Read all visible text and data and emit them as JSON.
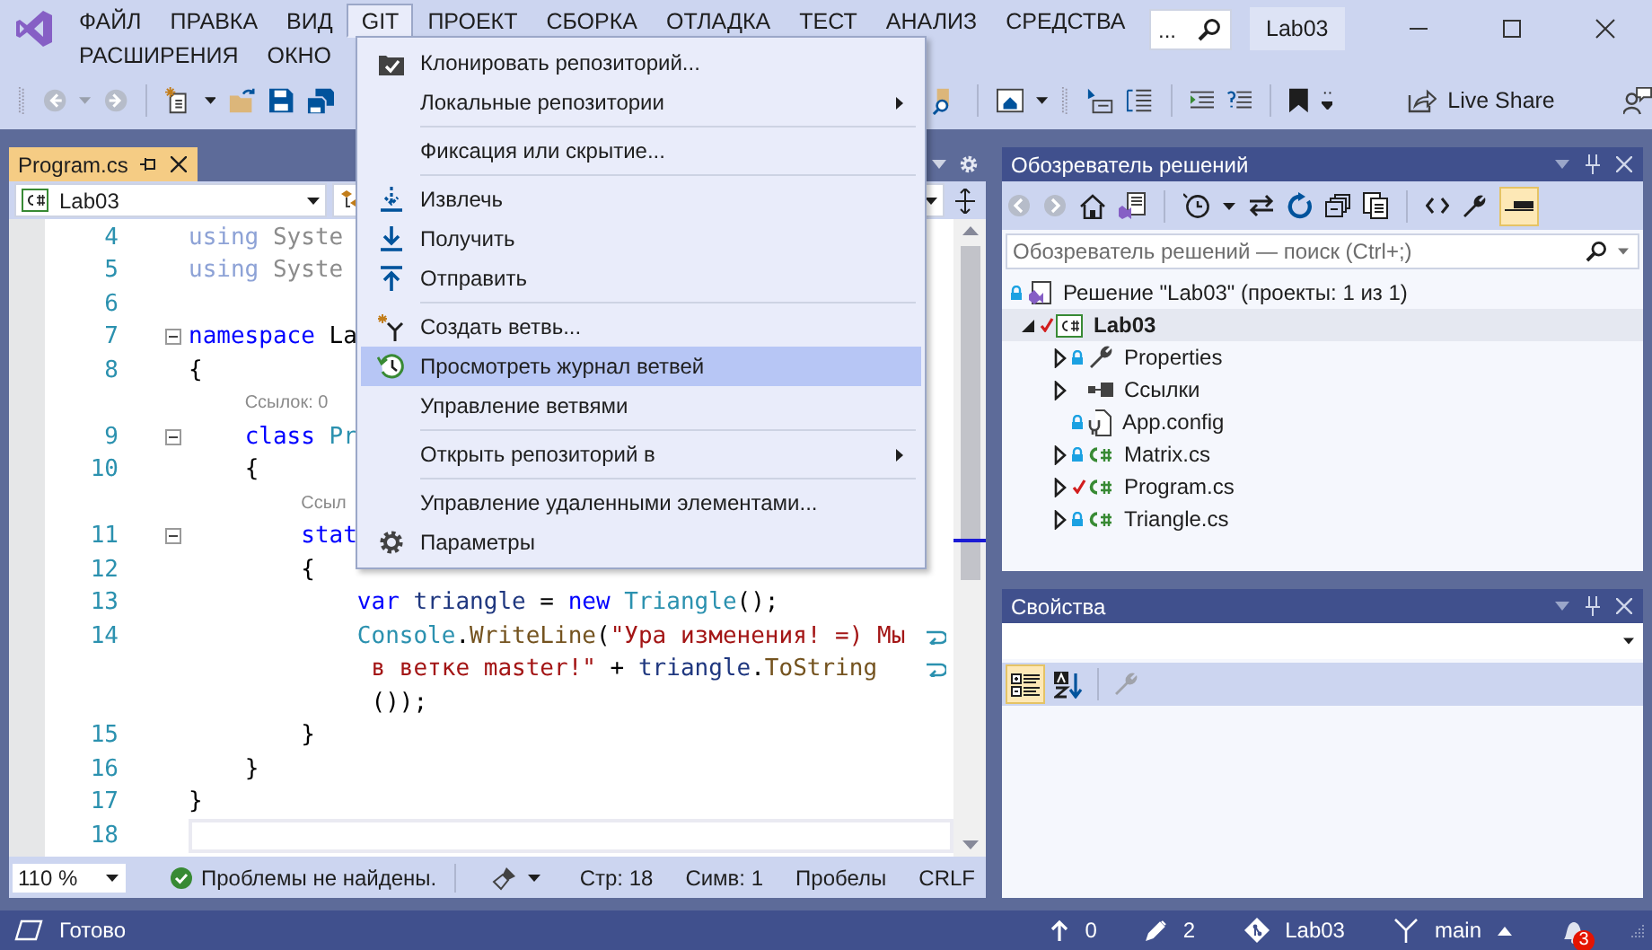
{
  "window": {
    "search": {
      "placeholder": "..."
    },
    "solution_name": "Lab03"
  },
  "menu_bar": {
    "items": [
      {
        "label": "ФАЙЛ",
        "selected": false
      },
      {
        "label": "ПРАВКА",
        "selected": false
      },
      {
        "label": "ВИД",
        "selected": false
      },
      {
        "label": "GIT",
        "selected": true
      },
      {
        "label": "ПРОЕКТ",
        "selected": false
      },
      {
        "label": "СБОРКА",
        "selected": false
      },
      {
        "label": "ОТЛАДКА",
        "selected": false
      },
      {
        "label": "ТЕСТ",
        "selected": false
      },
      {
        "label": "АНАЛИЗ",
        "selected": false
      },
      {
        "label": "СРЕДСТВА",
        "selected": false
      },
      {
        "label": "РАСШИРЕНИЯ",
        "selected": false
      },
      {
        "label": "ОКНО",
        "selected": false
      }
    ]
  },
  "toolbar": {
    "live_share": "Live Share"
  },
  "git_menu": {
    "items": [
      {
        "kind": "item",
        "label": "Клонировать репозиторий...",
        "submenu": false,
        "selected": false
      },
      {
        "kind": "item",
        "label": "Локальные репозитории",
        "submenu": true,
        "selected": false
      },
      {
        "kind": "separator"
      },
      {
        "kind": "item",
        "label": "Фиксация или скрытие...",
        "submenu": false,
        "selected": false
      },
      {
        "kind": "separator"
      },
      {
        "kind": "item",
        "label": "Извлечь",
        "submenu": false,
        "selected": false
      },
      {
        "kind": "item",
        "label": "Получить",
        "submenu": false,
        "selected": false
      },
      {
        "kind": "item",
        "label": "Отправить",
        "submenu": false,
        "selected": false
      },
      {
        "kind": "separator"
      },
      {
        "kind": "item",
        "label": "Создать ветвь...",
        "submenu": false,
        "selected": false
      },
      {
        "kind": "item",
        "label": "Просмотреть журнал ветвей",
        "submenu": false,
        "selected": true
      },
      {
        "kind": "item",
        "label": "Управление ветвями",
        "submenu": false,
        "selected": false
      },
      {
        "kind": "separator"
      },
      {
        "kind": "item",
        "label": "Открыть репозиторий в",
        "submenu": true,
        "selected": false
      },
      {
        "kind": "separator"
      },
      {
        "kind": "item",
        "label": "Управление удаленными элементами...",
        "submenu": false,
        "selected": false
      },
      {
        "kind": "item",
        "label": "Параметры",
        "submenu": false,
        "selected": false
      }
    ]
  },
  "editor": {
    "tab": {
      "label": "Program.cs",
      "selected": true
    },
    "project_selector": "Lab03",
    "lines": [
      {
        "kind": "code",
        "number": "4",
        "foldable": false,
        "tokens": [
          {
            "kind": "dim_keyword",
            "text": "using"
          },
          {
            "kind": "dim",
            "text": " Syste"
          }
        ]
      },
      {
        "kind": "code",
        "number": "5",
        "foldable": false,
        "tokens": [
          {
            "kind": "dim_keyword",
            "text": "using"
          },
          {
            "kind": "dim",
            "text": " Syste"
          }
        ]
      },
      {
        "kind": "code",
        "number": "6",
        "foldable": false
      },
      {
        "kind": "code",
        "number": "7",
        "foldable": true,
        "tokens": [
          {
            "kind": "keyword",
            "text": "namespace"
          },
          {
            "kind": "plain",
            "text": " La"
          }
        ]
      },
      {
        "kind": "code",
        "number": "8",
        "foldable": false,
        "tokens": [
          {
            "kind": "plain",
            "text": "{"
          }
        ]
      },
      {
        "kind": "codelens",
        "text": "Ссылок: 0"
      },
      {
        "kind": "code",
        "number": "9",
        "foldable": true,
        "tokens": [
          {
            "kind": "keyword",
            "text": "    class"
          },
          {
            "kind": "type",
            "text": " Pr"
          }
        ]
      },
      {
        "kind": "code",
        "number": "10",
        "foldable": false,
        "tokens": [
          {
            "kind": "plain",
            "text": "    {"
          }
        ]
      },
      {
        "kind": "codelens",
        "text": "Ссыл"
      },
      {
        "kind": "code",
        "number": "11",
        "foldable": true,
        "tokens": [
          {
            "kind": "keyword",
            "text": "        stat"
          }
        ]
      },
      {
        "kind": "code",
        "number": "12",
        "foldable": false,
        "tokens": [
          {
            "kind": "plain",
            "text": "        {"
          }
        ]
      },
      {
        "kind": "code",
        "number": "13",
        "foldable": false,
        "tokens": [
          {
            "kind": "keyword",
            "text": "            var"
          },
          {
            "kind": "local",
            "text": " triangle"
          },
          {
            "kind": "plain",
            "text": " = "
          },
          {
            "kind": "keyword",
            "text": "new"
          },
          {
            "kind": "type",
            "text": " Triangle"
          },
          {
            "kind": "plain",
            "text": "();"
          }
        ]
      },
      {
        "kind": "code",
        "number": "14",
        "foldable": false,
        "wrapped": true,
        "tokens": [
          {
            "kind": "type",
            "text": "            Console"
          },
          {
            "kind": "plain",
            "text": "."
          },
          {
            "kind": "method",
            "text": "WriteLine"
          },
          {
            "kind": "plain",
            "text": "("
          },
          {
            "kind": "string",
            "text": "\"Ура изменения! =) Мы"
          }
        ]
      },
      {
        "kind": "continuation",
        "wrapped": true,
        "tokens": [
          {
            "kind": "string",
            "text": "             в ветке master!\""
          },
          {
            "kind": "plain",
            "text": " + "
          },
          {
            "kind": "local",
            "text": "triangle"
          },
          {
            "kind": "plain",
            "text": "."
          },
          {
            "kind": "method",
            "text": "ToString"
          }
        ]
      },
      {
        "kind": "continuation",
        "tokens": [
          {
            "kind": "plain",
            "text": "             ());"
          }
        ]
      },
      {
        "kind": "code",
        "number": "15",
        "foldable": false,
        "tokens": [
          {
            "kind": "plain",
            "text": "        }"
          }
        ]
      },
      {
        "kind": "code",
        "number": "16",
        "foldable": false,
        "tokens": [
          {
            "kind": "plain",
            "text": "    }"
          }
        ]
      },
      {
        "kind": "code",
        "number": "17",
        "foldable": false,
        "tokens": [
          {
            "kind": "plain",
            "text": "}"
          }
        ]
      },
      {
        "kind": "code",
        "number": "18",
        "foldable": false,
        "current": true
      }
    ],
    "status": {
      "zoom": "110 %",
      "issues": "Проблемы не найдены.",
      "line": "Стр: 18",
      "column": "Симв: 1",
      "indent": "Пробелы",
      "line_ending": "CRLF"
    }
  },
  "solution_explorer": {
    "title": "Обозреватель решений",
    "search": {
      "placeholder": "Обозреватель решений — поиск (Ctrl+;)"
    },
    "tree": [
      {
        "kind": "solution",
        "label": "Решение \"Lab03\" (проекты: 1 из 1)",
        "locked": true,
        "modified": false,
        "selected": false,
        "children": [
          {
            "kind": "project",
            "label": "Lab03",
            "locked": false,
            "modified": true,
            "expanded": true,
            "selected": true,
            "children": [
              {
                "kind": "properties",
                "label": "Properties",
                "locked": true,
                "modified": false,
                "expanded": false,
                "selected": false
              },
              {
                "kind": "references",
                "label": "Ссылки",
                "locked": false,
                "modified": false,
                "expanded": false,
                "selected": false
              },
              {
                "kind": "config",
                "label": "App.config",
                "locked": true,
                "modified": false,
                "selected": false
              },
              {
                "kind": "csharp",
                "label": "Matrix.cs",
                "locked": true,
                "modified": false,
                "expanded": false,
                "selected": false
              },
              {
                "kind": "csharp",
                "label": "Program.cs",
                "locked": false,
                "modified": true,
                "expanded": false,
                "selected": false
              },
              {
                "kind": "csharp",
                "label": "Triangle.cs",
                "locked": true,
                "modified": false,
                "expanded": false,
                "selected": false
              }
            ]
          }
        ]
      }
    ]
  },
  "properties": {
    "title": "Свойства"
  },
  "status_bar": {
    "text": "Готово",
    "outgoing": "0",
    "changes": "2",
    "repository": "Lab03",
    "branch": "main",
    "notifications": "3"
  }
}
